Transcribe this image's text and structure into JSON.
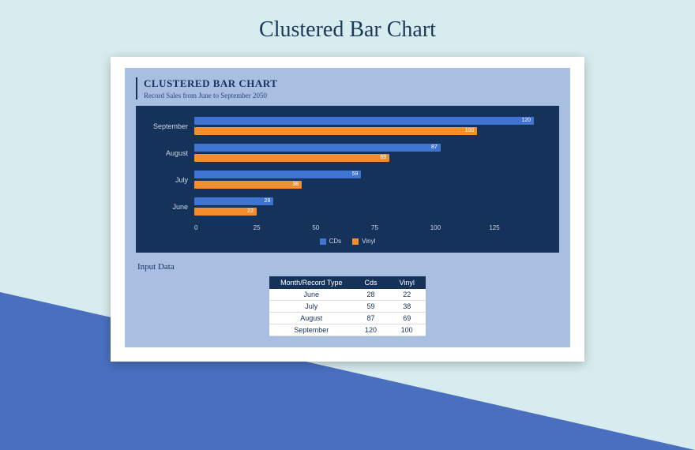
{
  "page_title": "Clustered Bar Chart",
  "chart": {
    "title": "CLUSTERED BAR CHART",
    "subtitle": "Record Sales from June to September 2050",
    "xmax": 125,
    "ticks": [
      "0",
      "25",
      "50",
      "75",
      "100",
      "125"
    ],
    "legend": {
      "cds": "CDs",
      "vinyl": "Vinyl"
    }
  },
  "table": {
    "title": "Input Data",
    "headers": {
      "month": "Month/Record Type",
      "cds": "Cds",
      "vinyl": "Vinyl"
    }
  },
  "chart_data": {
    "type": "bar",
    "orientation": "horizontal",
    "grouped": true,
    "categories": [
      "June",
      "July",
      "August",
      "September"
    ],
    "display_order": [
      "September",
      "August",
      "July",
      "June"
    ],
    "series": [
      {
        "name": "CDs",
        "values": [
          28,
          59,
          87,
          120
        ],
        "color": "#3f74d1"
      },
      {
        "name": "Vinyl",
        "values": [
          22,
          38,
          69,
          100
        ],
        "color": "#f28f2c"
      }
    ],
    "xlim": [
      0,
      125
    ],
    "title": "CLUSTERED BAR CHART",
    "subtitle": "Record Sales from June to September 2050",
    "xlabel": "",
    "ylabel": ""
  }
}
